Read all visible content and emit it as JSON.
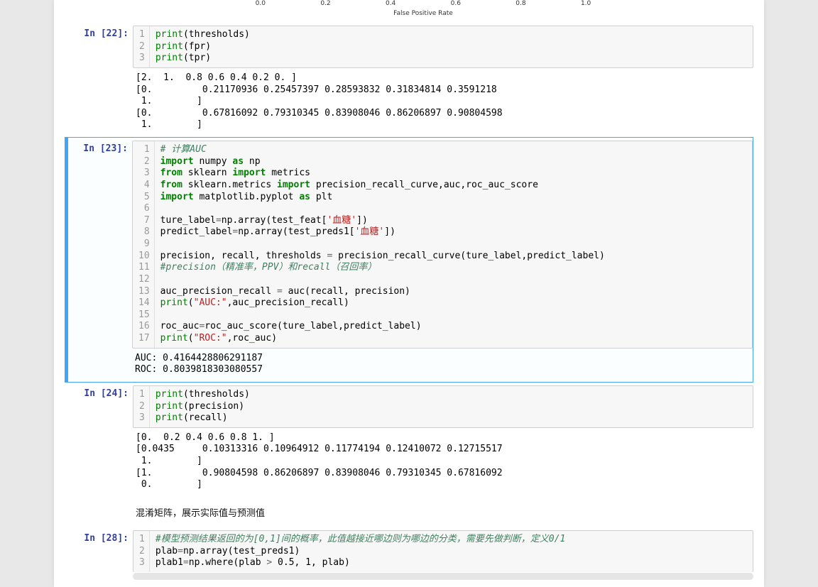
{
  "plot_tail": {
    "ticks": [
      "0.0",
      "0.2",
      "0.4",
      "0.6",
      "0.8",
      "1.0"
    ],
    "xlabel": "False Positive Rate"
  },
  "cells": [
    {
      "id": "c22",
      "prompt": "In [22]:",
      "linenos": "1\n2\n3",
      "code_lines": [
        [
          [
            "nb",
            "print"
          ],
          [
            "p",
            "(thresholds)"
          ]
        ],
        [
          [
            "nb",
            "print"
          ],
          [
            "p",
            "(fpr)"
          ]
        ],
        [
          [
            "nb",
            "print"
          ],
          [
            "p",
            "(tpr)"
          ]
        ]
      ],
      "output": "[2.  1.  0.8 0.6 0.4 0.2 0. ]\n[0.         0.21170936 0.25457397 0.28593832 0.31834814 0.3591218\n 1.        ]\n[0.         0.67816092 0.79310345 0.83908046 0.86206897 0.90804598\n 1.        ]"
    },
    {
      "id": "c23",
      "prompt": "In [23]:",
      "selected": true,
      "linenos": "1\n2\n3\n4\n5\n6\n7\n8\n9\n10\n11\n12\n13\n14\n15\n16\n17",
      "code_lines": [
        [
          [
            "c",
            "# 计算AUC"
          ]
        ],
        [
          [
            "k",
            "import"
          ],
          [
            "p",
            " numpy "
          ],
          [
            "k",
            "as"
          ],
          [
            "p",
            " np"
          ]
        ],
        [
          [
            "k",
            "from"
          ],
          [
            "p",
            " sklearn "
          ],
          [
            "k",
            "import"
          ],
          [
            "p",
            " metrics"
          ]
        ],
        [
          [
            "k",
            "from"
          ],
          [
            "p",
            " sklearn.metrics "
          ],
          [
            "k",
            "import"
          ],
          [
            "p",
            " precision_recall_curve,auc,roc_auc_score"
          ]
        ],
        [
          [
            "k",
            "import"
          ],
          [
            "p",
            " matplotlib.pyplot "
          ],
          [
            "k",
            "as"
          ],
          [
            "p",
            " plt"
          ]
        ],
        [],
        [
          [
            "p",
            "ture_label"
          ],
          [
            "o",
            "="
          ],
          [
            "p",
            "np.array(test_feat["
          ],
          [
            "s",
            "'血糖'"
          ],
          [
            "p",
            "])"
          ]
        ],
        [
          [
            "p",
            "predict_label"
          ],
          [
            "o",
            "="
          ],
          [
            "p",
            "np.array(test_preds1["
          ],
          [
            "s",
            "'血糖'"
          ],
          [
            "p",
            "])"
          ]
        ],
        [],
        [
          [
            "p",
            "precision, recall, thresholds "
          ],
          [
            "o",
            "="
          ],
          [
            "p",
            " precision_recall_curve(ture_label,predict_label)"
          ]
        ],
        [
          [
            "c",
            "#precision（精准率，PPV）和recall（召回率）"
          ]
        ],
        [],
        [
          [
            "p",
            "auc_precision_recall "
          ],
          [
            "o",
            "="
          ],
          [
            "p",
            " auc(recall, precision)"
          ]
        ],
        [
          [
            "nb",
            "print"
          ],
          [
            "p",
            "("
          ],
          [
            "s",
            "\"AUC:\""
          ],
          [
            "p",
            ",auc_precision_recall)"
          ]
        ],
        [],
        [
          [
            "p",
            "roc_auc"
          ],
          [
            "o",
            "="
          ],
          [
            "p",
            "roc_auc_score(ture_label,predict_label)"
          ]
        ],
        [
          [
            "nb",
            "print"
          ],
          [
            "p",
            "("
          ],
          [
            "s",
            "\"ROC:\""
          ],
          [
            "p",
            ",roc_auc)"
          ]
        ]
      ],
      "output": "AUC: 0.4164428806291187\nROC: 0.8039818303080557"
    },
    {
      "id": "c24",
      "prompt": "In [24]:",
      "linenos": "1\n2\n3",
      "code_lines": [
        [
          [
            "nb",
            "print"
          ],
          [
            "p",
            "(thresholds)"
          ]
        ],
        [
          [
            "nb",
            "print"
          ],
          [
            "p",
            "(precision)"
          ]
        ],
        [
          [
            "nb",
            "print"
          ],
          [
            "p",
            "(recall)"
          ]
        ]
      ],
      "output": "[0.  0.2 0.4 0.6 0.8 1. ]\n[0.0435     0.10313316 0.10964912 0.11774194 0.12410072 0.12715517\n 1.        ]\n[1.         0.90804598 0.86206897 0.83908046 0.79310345 0.67816092\n 0.        ]"
    },
    {
      "id": "md1",
      "markdown": "混淆矩阵，展示实际值与预测值"
    },
    {
      "id": "c28",
      "prompt": "In [28]:",
      "linenos": "1\n2\n3",
      "code_lines": [
        [
          [
            "c",
            "#模型预测结果返回的为[0,1]间的概率，此值越接近哪边则为哪边的分类，需要先做判断，定义0/1"
          ]
        ],
        [
          [
            "p",
            "plab"
          ],
          [
            "o",
            "="
          ],
          [
            "p",
            "np.array(test_preds1)"
          ]
        ],
        [
          [
            "p",
            "plab1"
          ],
          [
            "o",
            "="
          ],
          [
            "p",
            "np.where(plab "
          ],
          [
            "o",
            ">"
          ],
          [
            "p",
            " 0.5, 1, plab)"
          ]
        ]
      ]
    }
  ]
}
